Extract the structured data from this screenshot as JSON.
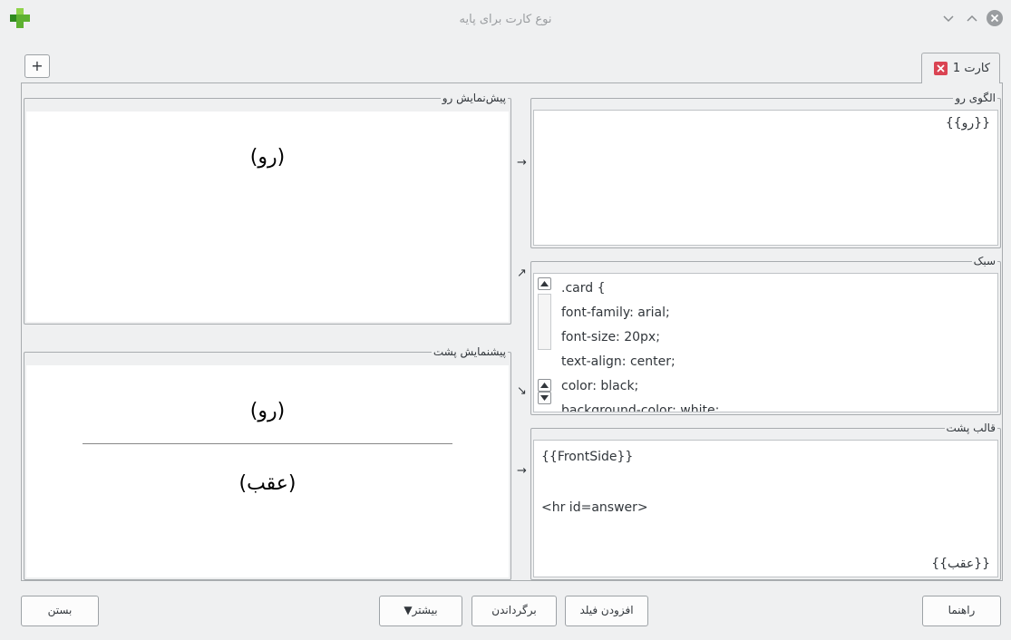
{
  "window": {
    "title": "نوع کارت برای پایه"
  },
  "tabs": {
    "add_label": "+",
    "active_label": "کارت 1"
  },
  "front_preview": {
    "title": "پیش‌نمایش رو",
    "content": "(رو)"
  },
  "back_preview": {
    "title": "پیشنمایش پشت",
    "front_content": "(رو)",
    "back_content": "(عقب)"
  },
  "front_template": {
    "title": "الگوی رو",
    "content": "{{رو}}"
  },
  "styling": {
    "title": "سبک",
    "lines": [
      ".card {",
      " font-family: arial;",
      " font-size: 20px;",
      " text-align: center;",
      " color: black;",
      " background-color: white;"
    ]
  },
  "back_template": {
    "title": "قالب پشت",
    "line1": "{{FrontSide}}",
    "line2": "<hr id=answer>",
    "line3": "{{عقب}}"
  },
  "arrows": {
    "front": "→",
    "style_up": "↗",
    "style_down": "↘",
    "back": "→"
  },
  "buttons": {
    "close": "بستن",
    "more": "بیشتر▼",
    "restore": "برگرداندن",
    "add_field": "افزودن فیلد",
    "help": "راهنما"
  },
  "colors": {
    "accent_green": "#3daee9",
    "close_red": "#da4453"
  }
}
